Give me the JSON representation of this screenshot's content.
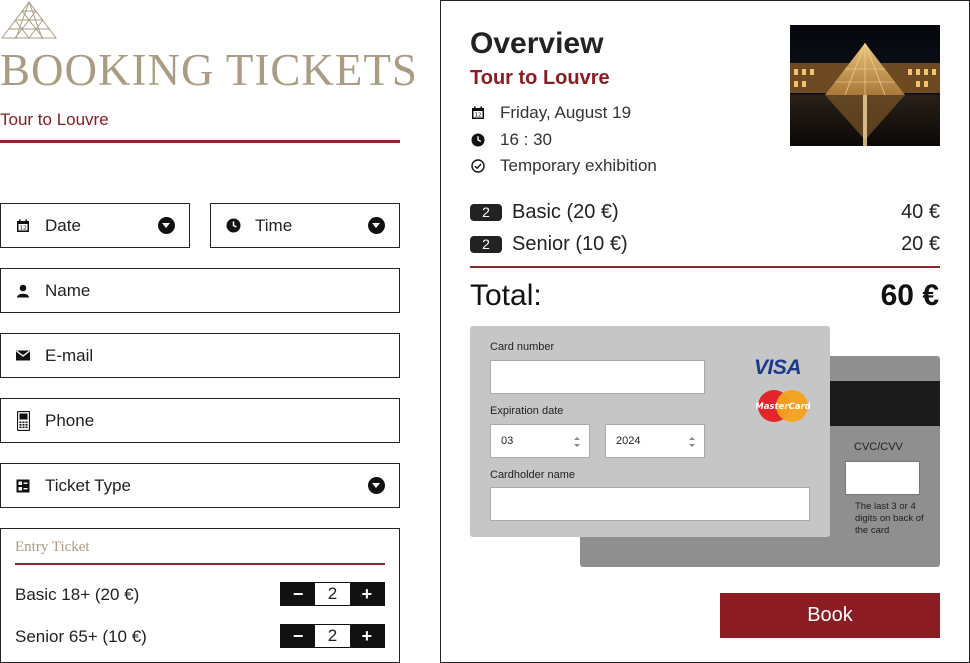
{
  "header": {
    "title": "BOOKING TICKETS",
    "subtitle": "Tour to Louvre"
  },
  "form": {
    "date_label": "Date",
    "time_label": "Time",
    "name_label": "Name",
    "email_label": "E-mail",
    "phone_label": "Phone",
    "ticket_type_label": "Ticket Type"
  },
  "entry": {
    "title": "Entry Ticket",
    "rows": [
      {
        "label": "Basic 18+ (20 €)",
        "qty": "2",
        "minus": "−",
        "plus": "+"
      },
      {
        "label": "Senior 65+ (10 €)",
        "qty": "2",
        "minus": "−",
        "plus": "+"
      }
    ]
  },
  "overview": {
    "title": "Overview",
    "tour": "Tour to Louvre",
    "date": "Friday, August 19",
    "time": "16 : 30",
    "exhibition": "Temporary exhibition",
    "tickets": [
      {
        "qty": "2",
        "name": "Basic (20 €)",
        "price": "40 €"
      },
      {
        "qty": "2",
        "name": "Senior (10 €)",
        "price": "20 €"
      }
    ],
    "total_label": "Total:",
    "total_value": "60 €"
  },
  "payment": {
    "card_number_label": "Card number",
    "expiration_label": "Expiration date",
    "exp_month": "03",
    "exp_year": "2024",
    "cardholder_label": "Cardholder name",
    "cvc_label": "CVC/CVV",
    "cvc_help": "The last 3 or 4 digits on back of the card",
    "visa_text": "VISA",
    "mastercard_text": "MasterCard"
  },
  "actions": {
    "book_label": "Book"
  },
  "colors": {
    "accent": "#8a1c22",
    "gold": "#a99c82",
    "dark": "#111111"
  }
}
